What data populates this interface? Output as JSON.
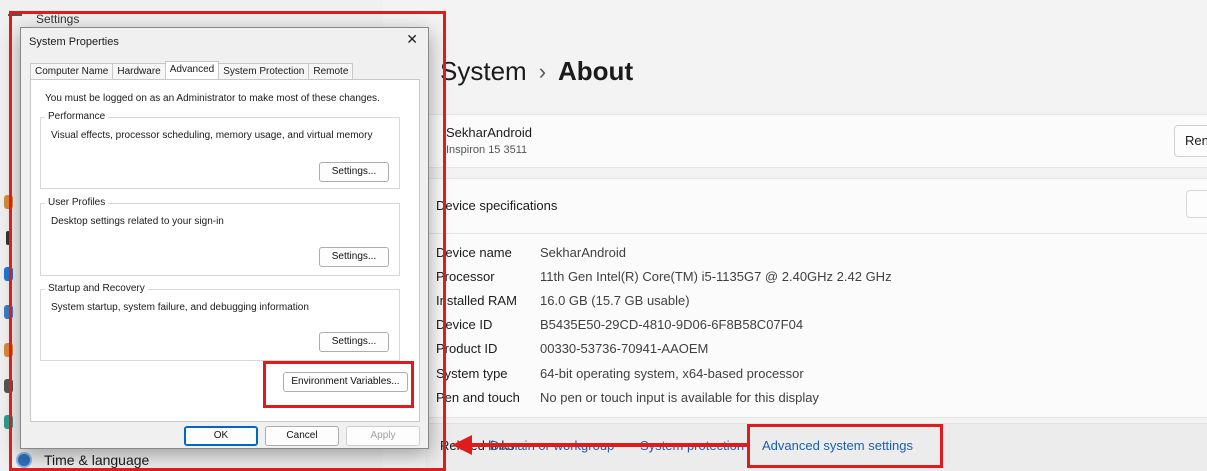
{
  "settings": {
    "window_title": "Settings",
    "breadcrumb_parent": "System",
    "breadcrumb_current": "About",
    "left_nav_item": "Time & language",
    "device_name": "SekharAndroid",
    "device_model": "Inspiron 15 3511",
    "rename_label": "Rename this PC",
    "spec_heading": "Device specifications",
    "specs": [
      {
        "key": "Device name",
        "value": "SekharAndroid"
      },
      {
        "key": "Processor",
        "value": "11th Gen Intel(R) Core(TM) i5-1135G7 @ 2.40GHz   2.42 GHz"
      },
      {
        "key": "Installed RAM",
        "value": "16.0 GB (15.7 GB usable)"
      },
      {
        "key": "Device ID",
        "value": "B5435E50-29CD-4810-9D06-6F8B58C07F04"
      },
      {
        "key": "Product ID",
        "value": "00330-53736-70941-AAOEM"
      },
      {
        "key": "System type",
        "value": "64-bit operating system, x64-based processor"
      },
      {
        "key": "Pen and touch",
        "value": "No pen or touch input is available for this display"
      }
    ],
    "related_label": "Related links",
    "related_links": [
      "Domain or workgroup",
      "System protection",
      "Advanced system settings"
    ]
  },
  "dialog": {
    "title": "System Properties",
    "close_glyph": "✕",
    "tabs": [
      "Computer Name",
      "Hardware",
      "Advanced",
      "System Protection",
      "Remote"
    ],
    "active_tab": "Advanced",
    "admin_note": "You must be logged on as an Administrator to make most of these changes.",
    "performance": {
      "title": "Performance",
      "desc": "Visual effects, processor scheduling, memory usage, and virtual memory",
      "button": "Settings..."
    },
    "user_profiles": {
      "title": "User Profiles",
      "desc": "Desktop settings related to your sign-in",
      "button": "Settings..."
    },
    "startup": {
      "title": "Startup and Recovery",
      "desc": "System startup, system failure, and debugging information",
      "button": "Settings..."
    },
    "env_button": "Environment Variables...",
    "ok": "OK",
    "cancel": "Cancel",
    "apply": "Apply"
  },
  "colors": {
    "annotation_red": "#e01b1b",
    "link_blue": "#1a5fb4"
  }
}
